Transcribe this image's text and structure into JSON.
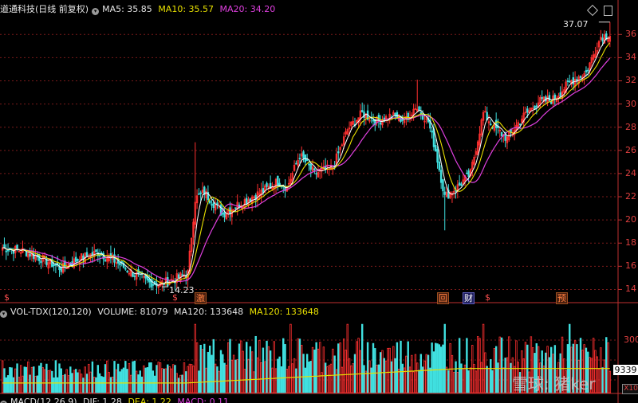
{
  "header": {
    "title": "道通科技(日线 前复权)",
    "ma5": "MA5: 35.85",
    "ma10": "MA10: 35.57",
    "ma20": "MA20: 34.20"
  },
  "vol_header": {
    "name": "VOL-TDX(120,120)",
    "volume": "VOLUME: 81079",
    "ma120a": "MA120: 133648",
    "ma120b": "MA120: 133648"
  },
  "macd_header": {
    "name": "MACD(12,26,9)",
    "dif": "DIF: 1.28",
    "dea": "DEA: 1.22",
    "macd": "MACD: 0.11"
  },
  "annotations": {
    "high": "37.07",
    "low": "14.23"
  },
  "badges": [
    "$",
    "$",
    "激",
    "回",
    "财",
    "$",
    "预"
  ],
  "vol_axis": {
    "tick": "300",
    "current": "9339",
    "unit": "X10"
  },
  "watermark": "雪球: 猪ker",
  "colors": {
    "up": "#ff3030",
    "down": "#40e0e0",
    "ma5": "#ffffff",
    "ma10": "#e8e000",
    "ma20": "#e040e0"
  },
  "chart_data": {
    "type": "candlestick",
    "title": "道通科技(日线 前复权)",
    "y_ticks": [
      14,
      16,
      18,
      20,
      22,
      24,
      26,
      28,
      30,
      32,
      34,
      36
    ],
    "ylim": [
      13.0,
      37.6
    ],
    "period_high": 37.07,
    "period_low": 14.23,
    "close_anchors": [
      [
        0,
        17.6
      ],
      [
        12,
        17.3
      ],
      [
        22,
        16.6
      ],
      [
        32,
        15.8
      ],
      [
        42,
        16.7
      ],
      [
        52,
        17.2
      ],
      [
        60,
        16.6
      ],
      [
        70,
        15.5
      ],
      [
        80,
        14.6
      ],
      [
        86,
        14.5
      ],
      [
        94,
        14.9
      ],
      [
        101,
        15.4
      ],
      [
        105,
        21.8
      ],
      [
        110,
        22.4
      ],
      [
        120,
        20.5
      ],
      [
        130,
        21.5
      ],
      [
        140,
        22.3
      ],
      [
        150,
        23.3
      ],
      [
        155,
        22.8
      ],
      [
        162,
        25.6
      ],
      [
        170,
        24.0
      ],
      [
        180,
        24.5
      ],
      [
        188,
        27.8
      ],
      [
        196,
        29.2
      ],
      [
        204,
        28.5
      ],
      [
        212,
        29.0
      ],
      [
        220,
        28.6
      ],
      [
        225,
        29.8
      ],
      [
        232,
        28.5
      ],
      [
        236,
        26.0
      ],
      [
        241,
        22.0
      ],
      [
        247,
        22.7
      ],
      [
        255,
        24.0
      ],
      [
        262,
        29.2
      ],
      [
        268,
        28.0
      ],
      [
        275,
        27.0
      ],
      [
        283,
        28.8
      ],
      [
        292,
        30.2
      ],
      [
        300,
        30.4
      ],
      [
        310,
        32.0
      ],
      [
        318,
        32.7
      ],
      [
        326,
        35.8
      ],
      [
        331,
        36.0
      ]
    ],
    "volume_ticks": [
      300
    ],
    "series": [
      {
        "name": "MA5",
        "value": 35.85
      },
      {
        "name": "MA10",
        "value": 35.57
      },
      {
        "name": "MA20",
        "value": 34.2
      }
    ]
  }
}
